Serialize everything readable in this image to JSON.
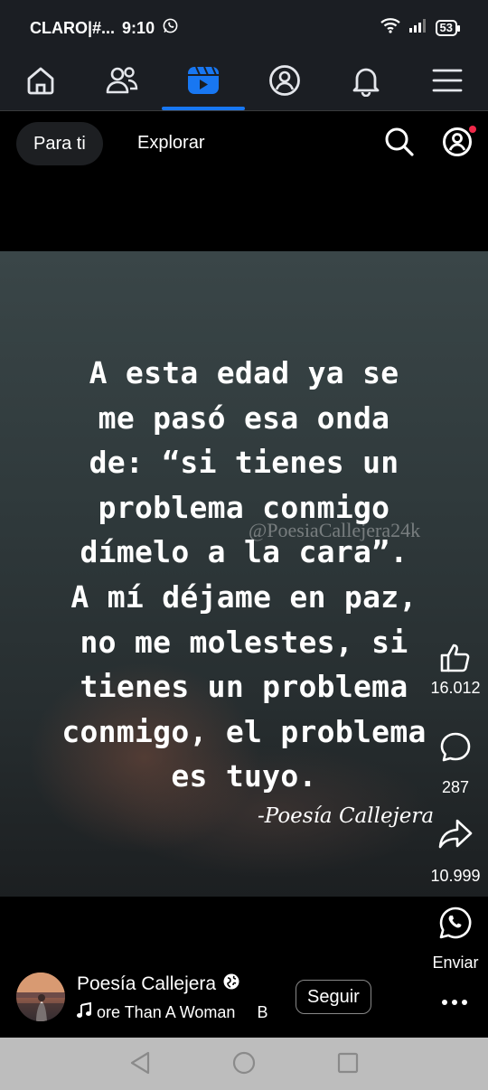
{
  "status_bar": {
    "carrier": "CLARO|#...",
    "time": "9:10",
    "battery": "53"
  },
  "nav": {
    "items": [
      {
        "name": "home",
        "icon": "home-icon",
        "active": false
      },
      {
        "name": "friends",
        "icon": "friends-icon",
        "active": false
      },
      {
        "name": "reels",
        "icon": "reels-icon",
        "active": true
      },
      {
        "name": "profile",
        "icon": "profile-icon",
        "active": false
      },
      {
        "name": "notifications",
        "icon": "bell-icon",
        "active": false
      },
      {
        "name": "menu",
        "icon": "hamburger-icon",
        "active": false
      }
    ],
    "accent": "#1877f2"
  },
  "tabs": {
    "for_you": "Para ti",
    "explore": "Explorar"
  },
  "post": {
    "quote_lines": [
      "A esta edad ya se",
      "me pasó esa onda",
      "de: “si tienes un",
      "problema conmigo",
      "dímelo a la cara”.",
      "A mí déjame en paz,",
      "no me molestes, si",
      "tienes un problema",
      "conmigo, el problema",
      "es tuyo."
    ],
    "watermark": "@PoesiaCallejera24k",
    "signature": "-Poesía Callejera"
  },
  "actions": {
    "likes": "16.012",
    "comments": "287",
    "shares": "10.999",
    "whatsapp_label": "Enviar"
  },
  "author": {
    "name": "Poesía Callejera",
    "song": "ore Than A Woman",
    "song_tail": "B",
    "follow_label": "Seguir"
  }
}
